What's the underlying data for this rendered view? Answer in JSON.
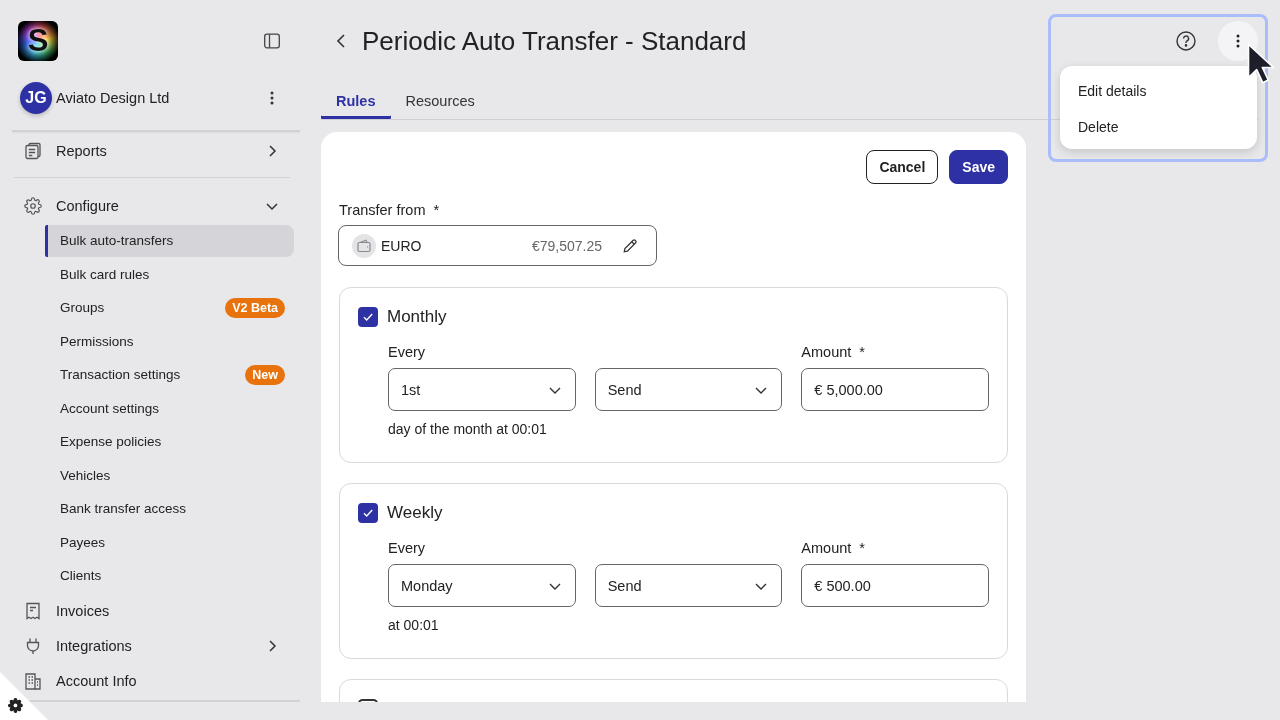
{
  "sidebar": {
    "logo": {
      "letter": "S"
    },
    "org": {
      "initials": "JG",
      "name": "Aviato Design Ltd"
    },
    "nav": [
      {
        "label": "Reports",
        "selected": false,
        "expanded": false
      },
      {
        "label": "Configure",
        "selected": false,
        "expanded": true,
        "children": [
          {
            "label": "Bulk auto-transfers",
            "selected": true
          },
          {
            "label": "Bulk card rules",
            "selected": false
          },
          {
            "label": "Groups",
            "selected": false,
            "badge": "V2 Beta"
          },
          {
            "label": "Permissions",
            "selected": false
          },
          {
            "label": "Transaction settings",
            "selected": false,
            "badge": "New"
          },
          {
            "label": "Account settings",
            "selected": false
          },
          {
            "label": "Expense policies",
            "selected": false
          },
          {
            "label": "Vehicles",
            "selected": false
          },
          {
            "label": "Bank transfer access",
            "selected": false
          },
          {
            "label": "Payees",
            "selected": false
          },
          {
            "label": "Clients",
            "selected": false
          }
        ]
      },
      {
        "label": "Invoices",
        "selected": false
      },
      {
        "label": "Integrations",
        "selected": false,
        "expanded": false
      },
      {
        "label": "Account Info",
        "selected": false
      }
    ]
  },
  "header": {
    "title": "Periodic Auto Transfer - Standard"
  },
  "tabs": [
    {
      "label": "Rules",
      "selected": true
    },
    {
      "label": "Resources",
      "selected": false
    }
  ],
  "actions": {
    "cancel": "Cancel",
    "save": "Save"
  },
  "transfer_from": {
    "label": "Transfer from",
    "required_mark": "*",
    "account": "EURO",
    "balance": "€79,507.25"
  },
  "rules": [
    {
      "label": "Monthly",
      "checked": true,
      "every_label": "Every",
      "every_value": "1st",
      "action_value": "Send",
      "amount_label": "Amount",
      "amount_required_mark": "*",
      "amount": "€ 5,000.00",
      "note": "day of the month at 00:01"
    },
    {
      "label": "Weekly",
      "checked": true,
      "every_label": "Every",
      "every_value": "Monday",
      "action_value": "Send",
      "amount_label": "Amount",
      "amount_required_mark": "*",
      "amount": "€ 500.00",
      "note": "at 00:01"
    },
    {
      "checked": false
    }
  ],
  "menu": {
    "open": true,
    "highlighted": true,
    "items": [
      "Edit details",
      "Delete"
    ]
  }
}
